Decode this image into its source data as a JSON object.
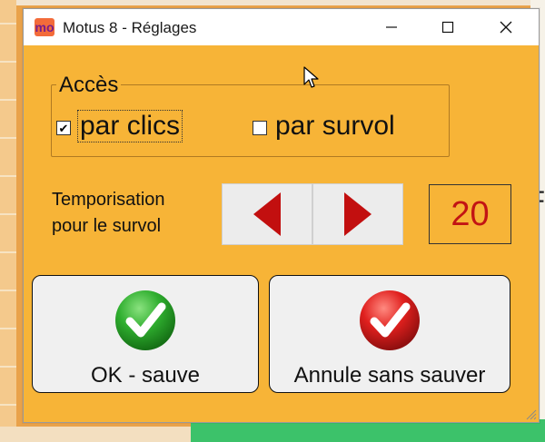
{
  "window": {
    "title": "Motus 8 - Réglages",
    "logo_text": "mo",
    "controls": [
      "minimize-icon",
      "maximize-icon",
      "close-icon"
    ]
  },
  "access": {
    "legend": "Accès",
    "option_clicks": {
      "label": "par clics",
      "checked": true
    },
    "option_hover": {
      "label": "par survol",
      "checked": false
    }
  },
  "delay": {
    "label_line1": "Temporisation",
    "label_line2": "pour le survol",
    "value": "20",
    "decrease_icon": "arrow-left-icon",
    "increase_icon": "arrow-right-icon"
  },
  "buttons": {
    "ok_label": "OK - sauve",
    "cancel_label": "Annule sans sauver"
  },
  "background": {
    "right_char": "F"
  },
  "colors": {
    "dialog_bg": "#f7b437",
    "value_text": "#c21414",
    "ok_icon": "#2fae2f",
    "cancel_icon": "#e0201e"
  }
}
